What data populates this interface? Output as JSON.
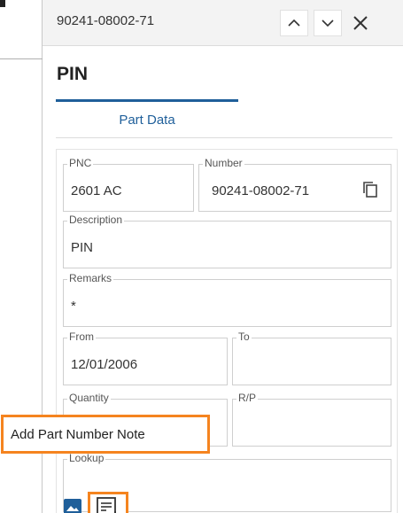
{
  "header": {
    "part_number": "90241-08002-71"
  },
  "title": "PIN",
  "tabs": [
    {
      "label": "Part Data",
      "active": true
    }
  ],
  "fields": {
    "pnc": {
      "label": "PNC",
      "value": "2601 AC"
    },
    "number": {
      "label": "Number",
      "value": "90241-08002-71"
    },
    "description": {
      "label": "Description",
      "value": "PIN"
    },
    "remarks": {
      "label": "Remarks",
      "value": "*"
    },
    "from": {
      "label": "From",
      "value": "12/01/2006"
    },
    "to": {
      "label": "To",
      "value": ""
    },
    "quantity": {
      "label": "Quantity",
      "value": ""
    },
    "rp": {
      "label": "R/P",
      "value": ""
    },
    "lookup": {
      "label": "Lookup"
    }
  },
  "tooltip": {
    "text": "Add Part Number Note"
  },
  "icons": {
    "up": "chevron-up-icon",
    "down": "chevron-down-icon",
    "close": "close-icon",
    "copy": "copy-icon",
    "image": "image-icon",
    "note": "add-note-icon"
  },
  "colors": {
    "accent": "#1f5f9a",
    "highlight": "#f5841f",
    "image_icon": "#1f5f9a"
  }
}
